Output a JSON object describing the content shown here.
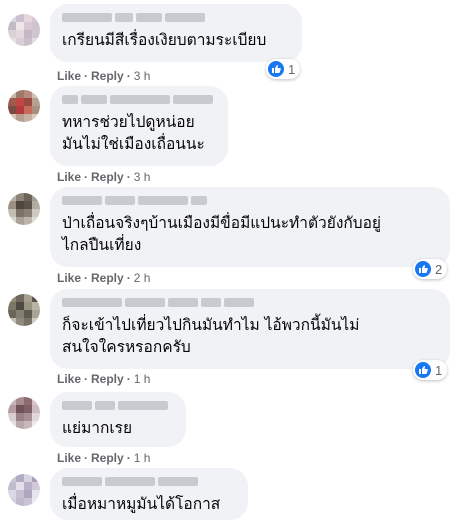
{
  "comments": [
    {
      "text": "เกรียนมีสีเรื่องเงิยบตามระเบียบ",
      "like_label": "Like",
      "reply_label": "Reply",
      "time": "3 h",
      "reactions": "1",
      "avatar_colors": [
        "#d9d9e0",
        "#c9c2cf",
        "#e7d6dd",
        "#d8c4d3",
        "#c3bac8",
        "#f0e6ea",
        "#d7c8d4",
        "#cfc3cf",
        "#ddd1d9",
        "#e3d8de",
        "#c8b7c4",
        "#d0c6cf",
        "#eadfe5",
        "#dacdd6",
        "#cbbfc9",
        "#e6dde2"
      ]
    },
    {
      "text": "ทหารช่วยไปดูหน่อย\nมันไม่ใช่เมืองเถื่อนนะ",
      "like_label": "Like",
      "reply_label": "Reply",
      "time": "3 h",
      "reactions": "",
      "avatar_colors": [
        "#c7b7a9",
        "#9c7b6b",
        "#b88a7b",
        "#d1c2b5",
        "#a05a4d",
        "#c04745",
        "#9a4a40",
        "#b6a08f",
        "#7a4b43",
        "#b23a3a",
        "#c96b5b",
        "#a88f80",
        "#d4c5b8",
        "#b79e8f",
        "#c5b0a2",
        "#d8ccc2"
      ]
    },
    {
      "text": "ป่าเถื่อนจริงๆบ้านเมืองมีขื่อมีแปนะทำตัวยังกับอยู่\nไกลปืนเที่ยง",
      "like_label": "Like",
      "reply_label": "Reply",
      "time": "2 h",
      "reactions": "2",
      "avatar_colors": [
        "#b8b2a9",
        "#8c8378",
        "#6d6358",
        "#a59d93",
        "#9b8f82",
        "#4e463f",
        "#5a5249",
        "#b3aca2",
        "#c3bdb5",
        "#7b7268",
        "#8a8075",
        "#cfc9c2",
        "#d9d4ce",
        "#aaa298",
        "#bdb6ad",
        "#e1ddd8"
      ]
    },
    {
      "text": "ก็จะเข้าไปเที่ยวไปกินมันทำไม ไอ้พวกนี้มันไม่\nสนใจใครหรอกครับ",
      "like_label": "Like",
      "reply_label": "Reply",
      "time": "1 h",
      "reactions": "1",
      "avatar_colors": [
        "#8f8a7a",
        "#6f6a5c",
        "#a49f8f",
        "#58544a",
        "#7b7666",
        "#4c4a42",
        "#999482",
        "#b9b4a4",
        "#6a6658",
        "#838070",
        "#5f5b4e",
        "#a8a393",
        "#c4bfb0",
        "#908b7c",
        "#767264",
        "#d0cbbd"
      ]
    },
    {
      "text": "แย่มากเรย",
      "like_label": "Like",
      "reply_label": "Reply",
      "time": "1 h",
      "reactions": "",
      "avatar_colors": [
        "#c7b4b6",
        "#a58c90",
        "#8c6b70",
        "#d4c6c8",
        "#b49da0",
        "#6f5157",
        "#7e5f65",
        "#cdbcbf",
        "#dacdcf",
        "#9a7f84",
        "#a88f93",
        "#e1d6d8",
        "#e8dfe0",
        "#bba6a9",
        "#c9b8bb",
        "#efe8e9"
      ]
    },
    {
      "text": "เมื่อหมาหมูมันได้โอกาส",
      "like_label": "",
      "reply_label": "",
      "time": "",
      "reactions": "",
      "avatar_colors": [
        "#cbc6d6",
        "#b2acc2",
        "#d9d4e2",
        "#a7a0b8",
        "#c1bbce",
        "#e4e0ea",
        "#b8b1c8",
        "#d0cadb",
        "#dcd7e4",
        "#c6c0d2",
        "#aea7be",
        "#e8e4ee",
        "#d5d0df",
        "#bfb9cc",
        "#cac4d5",
        "#ece9f1"
      ]
    }
  ]
}
